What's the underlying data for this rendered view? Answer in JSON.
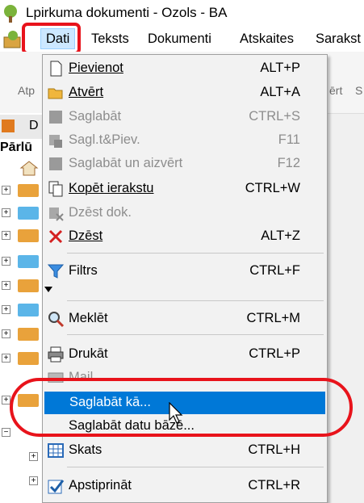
{
  "window": {
    "title": "Lpirkuma dokumenti - Ozols - BA"
  },
  "menubar": [
    {
      "label": "Dati",
      "active": true
    },
    {
      "label": "Teksts"
    },
    {
      "label": "Dokumenti"
    },
    {
      "label": "Atskaites"
    },
    {
      "label": "Sarakst"
    }
  ],
  "toolbar": {
    "frag_left": "Atp",
    "frag_right1": "ērt",
    "frag_right2": "S"
  },
  "left_panel": {
    "tab": "D",
    "header": "Pārlū"
  },
  "dropdown": {
    "items": [
      {
        "label": "Pievienot",
        "shortcut": "ALT+P",
        "icon": "new-page-icon",
        "enabled": true
      },
      {
        "label": "Atvērt",
        "shortcut": "ALT+A",
        "icon": "open-folder-icon",
        "enabled": true
      },
      {
        "label": "Saglabāt",
        "shortcut": "CTRL+S",
        "icon": "save-icon",
        "enabled": false
      },
      {
        "label": "Sagl.t&Piev.",
        "shortcut": "F11",
        "icon": "save-add-icon",
        "enabled": false
      },
      {
        "label": "Saglabāt un aizvērt",
        "shortcut": "F12",
        "icon": "save-close-icon",
        "enabled": false
      },
      {
        "label": "Kopēt ierakstu",
        "shortcut": "CTRL+W",
        "icon": "copy-icon",
        "enabled": true
      },
      {
        "label": "Dzēst dok.",
        "shortcut": "",
        "icon": "delete-doc-icon",
        "enabled": false
      },
      {
        "label": "Dzēst",
        "shortcut": "ALT+Z",
        "icon": "delete-x-icon",
        "enabled": true
      },
      {
        "label": "Filtrs",
        "shortcut": "CTRL+F",
        "icon": "filter-icon",
        "enabled": true
      },
      {
        "label": "Meklēt",
        "shortcut": "CTRL+M",
        "icon": "search-icon",
        "enabled": true
      },
      {
        "label": "Drukāt",
        "shortcut": "CTRL+P",
        "icon": "printer-icon",
        "enabled": true
      },
      {
        "label": "Mail",
        "shortcut": "",
        "icon": "mail-icon",
        "enabled": false
      },
      {
        "label": "Saglabāt kā...",
        "shortcut": "",
        "icon": "",
        "enabled": true,
        "selected": true
      },
      {
        "label": "Saglabāt datu bāzē...",
        "shortcut": "",
        "icon": "",
        "enabled": true
      },
      {
        "label": "Skats",
        "shortcut": "CTRL+H",
        "icon": "grid-view-icon",
        "enabled": true
      },
      {
        "label": "Apstiprināt",
        "shortcut": "CTRL+R",
        "icon": "checkmark-icon",
        "enabled": true
      }
    ]
  },
  "colors": {
    "highlight_red": "#e8131b",
    "selection_blue": "#0078d7"
  }
}
